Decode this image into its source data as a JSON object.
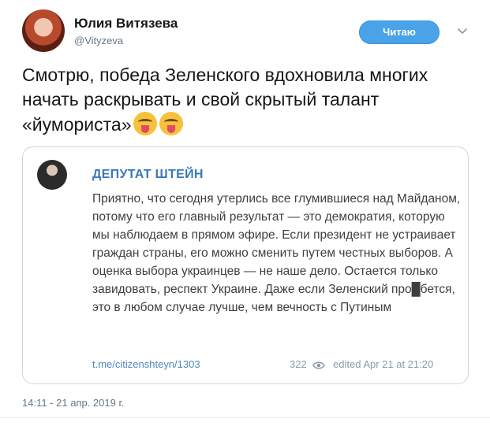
{
  "header": {
    "name": "Юлия Витязева",
    "handle": "@Vityzeva",
    "follow_label": "Читаю"
  },
  "tweet": {
    "text": "Смотрю, победа Зеленского вдохновила многих начать раскрывать и свой скрытый талант «йумориста»"
  },
  "quote": {
    "title": "ДЕПУТАТ ШТЕЙН",
    "body": "Приятно, что сегодня утерлись все глумившиеся над Майданом, потому что его главный результат — это демократия, которую мы наблюдаем в прямом эфире. Если президент не устраивает граждан страны, его можно сменить путем честных выборов. А оценка выбора украинцев — не наше дело. Остается только завидовать, респект Украине. Даже если Зеленский про█бется, это в любом случае лучше, чем вечность с Путиным",
    "link": "t.me/citizenshteyn/1303",
    "views": "322",
    "edited": "edited  Apr 21 at 21:20"
  },
  "footer": {
    "timestamp": "14:11 - 21 апр. 2019 г."
  },
  "icons": {
    "chevron": "chevron-down-icon",
    "eye": "eye-icon",
    "emoji": "squinting-tongue-emoji"
  },
  "colors": {
    "follow_button": "#4aa3e8",
    "quote_title": "#3a78b8",
    "link": "#4f87c2"
  }
}
